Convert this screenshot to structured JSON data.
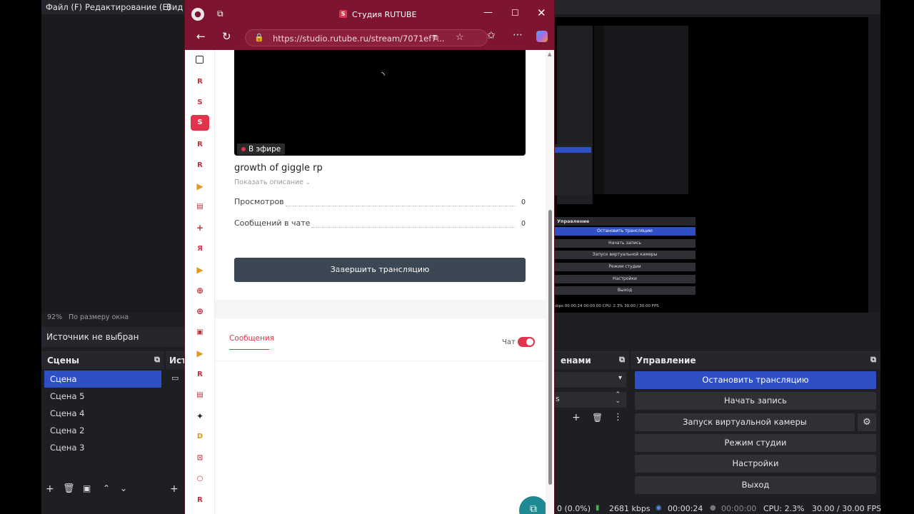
{
  "obs": {
    "menu": [
      "Файл (F)",
      "Редактирование (E)",
      "Вид ("
    ],
    "zoom": "92%",
    "zoom_mode": "По размеру окна",
    "source_status": "Источник не выбран",
    "scenes_title": "Сцены",
    "sources_title_partial": "Исто",
    "scenes": [
      "Сцена",
      "Сцена 5",
      "Сцена 4",
      "Сцена 2",
      "Сцена 3"
    ],
    "mixer_title_partial": "енами",
    "mixer_value_partial": "s",
    "controls_title": "Управление",
    "controls": {
      "stop_stream": "Остановить трансляцию",
      "start_record": "Начать запись",
      "virtual_cam": "Запуск виртуальной камеры",
      "studio_mode": "Режим студии",
      "settings": "Настройки",
      "exit": "Выход"
    },
    "status": {
      "dropped": "0 (0.0%)",
      "bitrate": "2681 kbps",
      "stream_time": "00:00:24",
      "record_time": "00:00:00",
      "cpu": "CPU: 2.3%",
      "fps": "30.00 / 30.00 FPS"
    },
    "preview_mirror": {
      "controls_title": "Управление",
      "buttons": [
        "Остановить трансляцию",
        "Начать запись",
        "Запуск виртуальной камеры",
        "Режим студии",
        "Настройки",
        "Выход"
      ],
      "status": "kbps   00:00:24   00:00:00   CPU: 2.3%   30.00 / 30.00 FPS"
    }
  },
  "browser": {
    "title": "Студия RUTUBE",
    "url": "https://studio.rutube.ru/stream/7071ef7...",
    "sidebar_icons": [
      "tabs-icon",
      "rutube-icon",
      "studio-icon",
      "studio-active-icon",
      "rutube-icon",
      "rutube-icon",
      "play-icon",
      "calendar-icon",
      "plus-icon",
      "yandex-icon",
      "play-icon",
      "globe-icon",
      "globe-icon",
      "video-icon",
      "play-icon",
      "rutube-icon",
      "calendar-icon",
      "sparkle-icon",
      "chat-icon",
      "lock-icon",
      "search-icon",
      "rutube-icon"
    ]
  },
  "page": {
    "live_badge": "В эфире",
    "stream_title": "growth of giggle rp",
    "show_description": "Показать описание",
    "stats": [
      {
        "label": "Просмотров",
        "value": "0"
      },
      {
        "label": "Сообщений в чате",
        "value": "0"
      }
    ],
    "end_stream": "Завершить трансляцию",
    "tab_messages": "Сообщения",
    "chat_label": "Чат",
    "chat_enabled": true
  },
  "colors": {
    "edge_accent": "#7d1530",
    "obs_primary": "#2f4fc4",
    "rutube_red": "#e0344a"
  }
}
